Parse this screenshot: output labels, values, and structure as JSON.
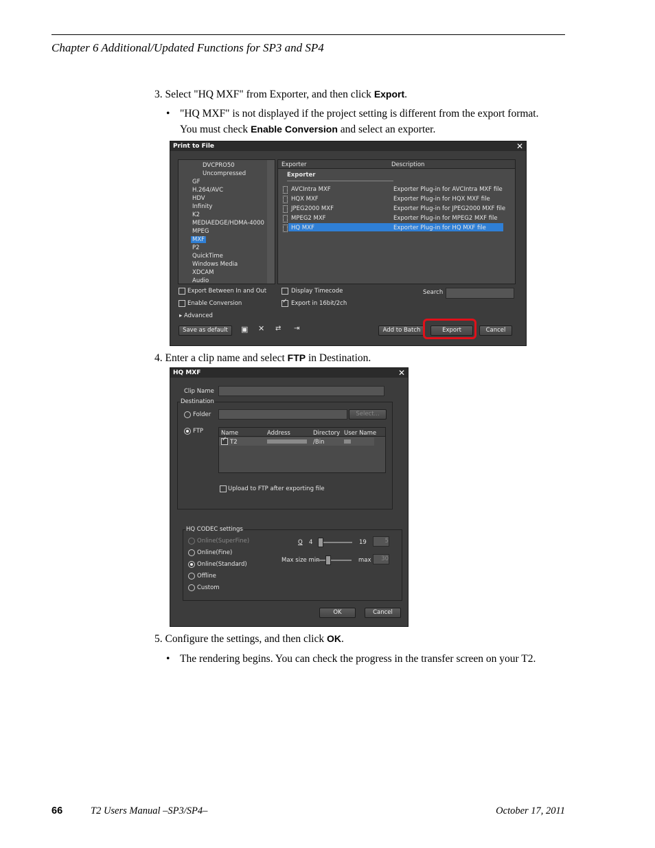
{
  "header": {
    "chapter": "Chapter 6   Additional/Updated Functions for SP3 and SP4"
  },
  "steps": {
    "s3_text": "3. Select \"HQ MXF\" from Exporter, and then click ",
    "s3_bold": "Export",
    "s3_end": ".",
    "s3_bullet_a": "\"HQ MXF\" is not displayed if the project setting is different from the export format. You must check ",
    "s3_bullet_bold": "Enable Conversion",
    "s3_bullet_b": " and select an exporter.",
    "s4_text": "4. Enter a clip name and select ",
    "s4_bold": "FTP",
    "s4_end": " in Destination.",
    "s5_text": "5. Configure the settings, and then click ",
    "s5_bold": "OK",
    "s5_end": ".",
    "s5_bullet": "The rendering begins. You can check the progress in the transfer screen on your T2.",
    "bullet_char": "•"
  },
  "print_dialog": {
    "title": "Print to File",
    "close": "✕",
    "tree": [
      "DVCPRO50",
      "Uncompressed",
      "GF",
      "H.264/AVC",
      "HDV",
      "Infinity",
      "K2",
      "MEDIAEDGE/HDMA-4000",
      "MPEG",
      "MXF",
      "P2",
      "QuickTime",
      "Windows Media",
      "XDCAM",
      "Audio"
    ],
    "columns": {
      "exporter": "Exporter",
      "description": "Description"
    },
    "group": "Exporter",
    "rows": [
      {
        "name": "AVCIntra MXF",
        "desc": "Exporter Plug-in for AVCIntra MXF file"
      },
      {
        "name": "HQX MXF",
        "desc": "Exporter Plug-in for HQX MXF file"
      },
      {
        "name": "JPEG2000 MXF",
        "desc": "Exporter Plug-in for JPEG2000 MXF file"
      },
      {
        "name": "MPEG2 MXF",
        "desc": "Exporter Plug-in for MPEG2 MXF file"
      },
      {
        "name": "HQ MXF",
        "desc": "Exporter Plug-in for HQ MXF file"
      }
    ],
    "export_between": "Export Between In and Out",
    "enable_conversion": "Enable Conversion",
    "display_timecode": "Display Timecode",
    "export_16bit": "Export in 16bit/2ch",
    "search": "Search",
    "advanced": "Advanced",
    "save_default": "Save as default",
    "add_batch": "Add to Batch List",
    "export": "Export",
    "cancel": "Cancel"
  },
  "hq_dialog": {
    "title": "HQ MXF",
    "close": "✕",
    "clip_name": "Clip Name",
    "destination": "Destination",
    "folder": "Folder",
    "select": "Select...",
    "ftp": "FTP",
    "cols": {
      "name": "Name",
      "address": "Address",
      "directory": "Directory",
      "user": "User Name"
    },
    "row": {
      "name": "T2",
      "directory": "/Bin"
    },
    "upload": "Upload to FTP after exporting file",
    "codec_group": "HQ CODEC settings",
    "opts": [
      "Online(SuperFine)",
      "Online(Fine)",
      "Online(Standard)",
      "Offline",
      "Custom"
    ],
    "q_label": "Q",
    "q_min": "4",
    "q_max": "19",
    "q_val": "5",
    "max_size": "Max size min",
    "max_label": "max",
    "max_val": "30",
    "ok": "OK",
    "cancel": "Cancel"
  },
  "footer": {
    "page": "66",
    "manual": "T2 Users Manual –SP3/SP4–",
    "date": "October 17, 2011"
  },
  "colors": {
    "highlight": "#e0101a",
    "selection": "#2f7fd6"
  }
}
